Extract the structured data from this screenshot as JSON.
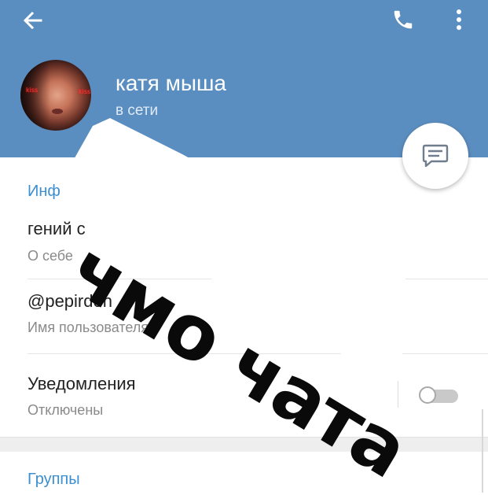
{
  "toolbar": {
    "back_icon": "arrow-left-icon",
    "call_icon": "phone-icon",
    "menu_icon": "more-vertical-icon"
  },
  "profile": {
    "name": "катя мыша",
    "status": "в сети",
    "avatar_overlay_text": "kiss"
  },
  "fab_icon": "message-icon",
  "info_section": {
    "title": "Инф",
    "bio_value": "гений с",
    "bio_label": "О себе",
    "username_value": "@pepirdon",
    "username_label": "Имя пользователя",
    "notifications_value": "Уведомления",
    "notifications_label": "Отключены",
    "notifications_enabled": false
  },
  "groups_section": {
    "title": "Группы"
  },
  "sticker": {
    "text": "чмо чата"
  },
  "colors": {
    "header": "#5b8ec0",
    "accent": "#3b8fd0",
    "sticker_text": "#0a0a0a"
  }
}
